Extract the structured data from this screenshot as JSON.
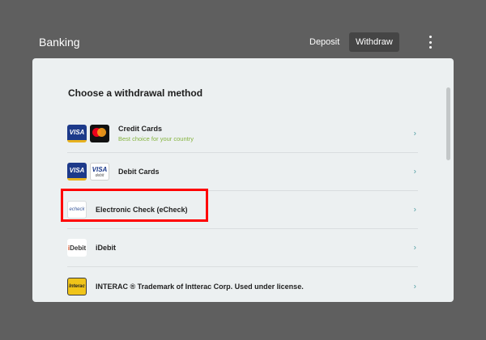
{
  "header": {
    "title": "Banking",
    "tabs": [
      {
        "label": "Deposit",
        "active": false
      },
      {
        "label": "Withdraw",
        "active": true
      }
    ],
    "menu_icon": "kebab-menu-icon"
  },
  "main": {
    "section_title": "Choose a withdrawal method",
    "methods": [
      {
        "name": "Credit Cards",
        "subtitle": "Best choice for your country",
        "logos": [
          "VISA",
          "mastercard"
        ]
      },
      {
        "name": "Debit Cards",
        "logos": [
          "VISA",
          "VISA",
          "debit"
        ]
      },
      {
        "name": "Electronic Check (eCheck)",
        "logos": [
          "echeck"
        ]
      },
      {
        "name": "iDebit",
        "logos": [
          "iDebit"
        ]
      },
      {
        "name": "INTERAC ® Trademark of Intterac Corp. Used under license.",
        "logos": [
          "Interac"
        ]
      }
    ],
    "chevron": "›"
  },
  "colors": {
    "background": "#5f5f5f",
    "panel": "#ecf0f1",
    "active_tab": "#454545",
    "subtitle_green": "#86b440",
    "chevron_teal": "#4f9ea2",
    "highlight_red": "#ff0000"
  }
}
